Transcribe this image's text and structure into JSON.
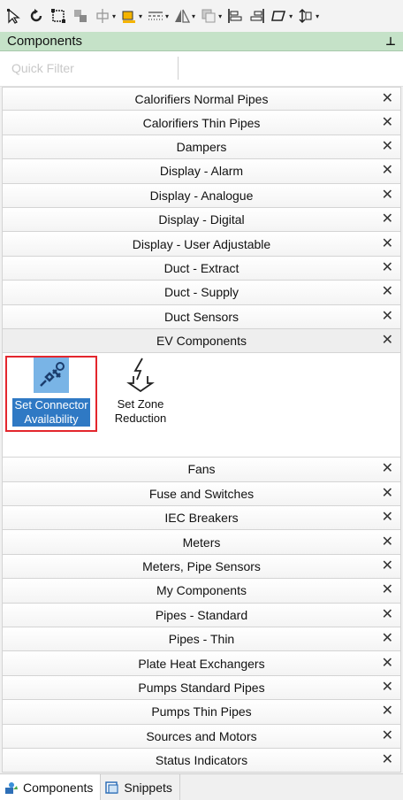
{
  "toolbar": {
    "buttons": [
      {
        "name": "select-arrow-icon",
        "dropdown": false
      },
      {
        "name": "rotate-icon",
        "dropdown": false
      },
      {
        "name": "select-frame-icon",
        "dropdown": false
      },
      {
        "name": "group-icon",
        "dropdown": false
      },
      {
        "name": "distribute-icon",
        "dropdown": true
      },
      {
        "name": "fill-color-icon",
        "dropdown": true
      },
      {
        "name": "line-style-icon",
        "dropdown": true
      },
      {
        "name": "flip-icon",
        "dropdown": true
      },
      {
        "name": "layer-icon",
        "dropdown": true
      },
      {
        "name": "align-left-icon",
        "dropdown": false
      },
      {
        "name": "align-right-icon",
        "dropdown": false
      },
      {
        "name": "shape-icon",
        "dropdown": true
      },
      {
        "name": "size-icon",
        "dropdown": true
      }
    ]
  },
  "panel": {
    "title": "Components",
    "pin_glyph": "⊥"
  },
  "filter": {
    "placeholder": "Quick Filter",
    "value": ""
  },
  "groups_before": [
    "Calorifiers Normal Pipes",
    "Calorifiers Thin Pipes",
    "Dampers",
    "Display - Alarm",
    "Display - Analogue",
    "Display - Digital",
    "Display - User Adjustable",
    "Duct - Extract",
    "Duct - Supply",
    "Duct Sensors"
  ],
  "expanded_group": {
    "label": "EV Components",
    "items": [
      {
        "label_line1": "Set Connector",
        "label_line2": "Availability",
        "icon": "plug-icon",
        "selected": true
      },
      {
        "label_line1": "Set Zone",
        "label_line2": "Reduction",
        "icon": "lightning-down-icon",
        "selected": false
      }
    ]
  },
  "groups_after": [
    "Fans",
    "Fuse and Switches",
    "IEC Breakers",
    "Meters",
    "Meters, Pipe Sensors",
    "My Components",
    "Pipes - Standard",
    "Pipes - Thin",
    "Plate Heat Exchangers",
    "Pumps Standard Pipes",
    "Pumps Thin Pipes",
    "Sources and Motors",
    "Status Indicators"
  ],
  "close_glyph": "✕",
  "bottom_tabs": [
    {
      "label": "Components",
      "active": true
    },
    {
      "label": "Snippets",
      "active": false
    }
  ],
  "colors": {
    "header_bg": "#c5e2c8",
    "selected_border": "#e3262d",
    "selected_label_bg": "#2f79c4"
  }
}
